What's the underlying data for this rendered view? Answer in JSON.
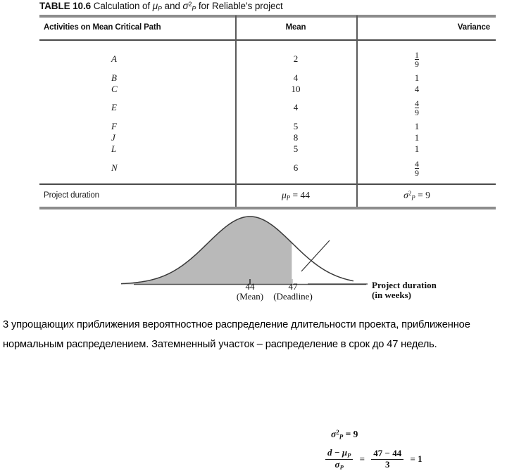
{
  "table": {
    "title_prefix": "TABLE 10.6",
    "title_rest": "Calculation of",
    "title_mu": "μ",
    "title_mu_sub": "P",
    "title_and": "and",
    "title_sigma": "σ",
    "title_sigma_sup": "2",
    "title_sigma_sub": "P",
    "title_tail": "for Reliable’s project",
    "headers": {
      "activities": "Activities on Mean Critical Path",
      "mean": "Mean",
      "variance": "Variance"
    },
    "rows": [
      {
        "activity": "A",
        "mean": "2",
        "var_num": "1",
        "var_den": "9",
        "var_whole": ""
      },
      {
        "activity": "B",
        "mean": "4",
        "var_num": "",
        "var_den": "",
        "var_whole": "1"
      },
      {
        "activity": "C",
        "mean": "10",
        "var_num": "",
        "var_den": "",
        "var_whole": "4"
      },
      {
        "activity": "E",
        "mean": "4",
        "var_num": "4",
        "var_den": "9",
        "var_whole": ""
      },
      {
        "activity": "F",
        "mean": "5",
        "var_num": "",
        "var_den": "",
        "var_whole": "1"
      },
      {
        "activity": "J",
        "mean": "8",
        "var_num": "",
        "var_den": "",
        "var_whole": "1"
      },
      {
        "activity": "L",
        "mean": "5",
        "var_num": "",
        "var_den": "",
        "var_whole": "1"
      },
      {
        "activity": "N",
        "mean": "6",
        "var_num": "4",
        "var_den": "9",
        "var_whole": ""
      }
    ],
    "summary": {
      "label": "Project duration",
      "mean_symbol": "μ",
      "mean_sub": "P",
      "mean_value": "= 44",
      "var_symbol": "σ",
      "var_sup": "2",
      "var_sub": "P",
      "var_value": "= 9"
    }
  },
  "figure": {
    "formula_variance": {
      "symbol": "σ",
      "sup": "2",
      "sub": "P",
      "value": "= 9"
    },
    "formula_z": {
      "numerator": "d − μ",
      "numerator_sub": "P",
      "denominator": "σ",
      "denominator_sub": "P",
      "eq1": "=",
      "rhs_num": "47 − 44",
      "rhs_den": "3",
      "eq2": "= 1"
    },
    "axis": {
      "mean_tick_value": "44",
      "mean_tick_label": "(Mean)",
      "deadline_tick_value": "47",
      "deadline_tick_label": "(Deadline)",
      "axis_label_line1": "Project duration",
      "axis_label_line2": "(in weeks)"
    },
    "colors": {
      "shade_fill": "#b9b9b9",
      "curve_stroke": "#3a3a3a",
      "axis_stroke": "#555555"
    }
  },
  "caption": {
    "line1": "3 упрощающих приближения вероятностное распределение длительности проекта, приближенное нормальным распределением. Затемненный участок – распределение в срок до 47 недель."
  },
  "chart_data": {
    "type": "area",
    "title": "",
    "xlabel": "Project duration (in weeks)",
    "ylabel": "",
    "distribution": "normal",
    "mean": 44,
    "variance": 9,
    "std_dev": 3,
    "deadline": 47,
    "z_score": 1,
    "shaded_region": {
      "from": "-infinity",
      "to": 47
    },
    "tick_labels": [
      "44",
      "47"
    ],
    "tick_annotations": [
      "(Mean)",
      "(Deadline)"
    ],
    "grid": false,
    "legend": "none"
  }
}
